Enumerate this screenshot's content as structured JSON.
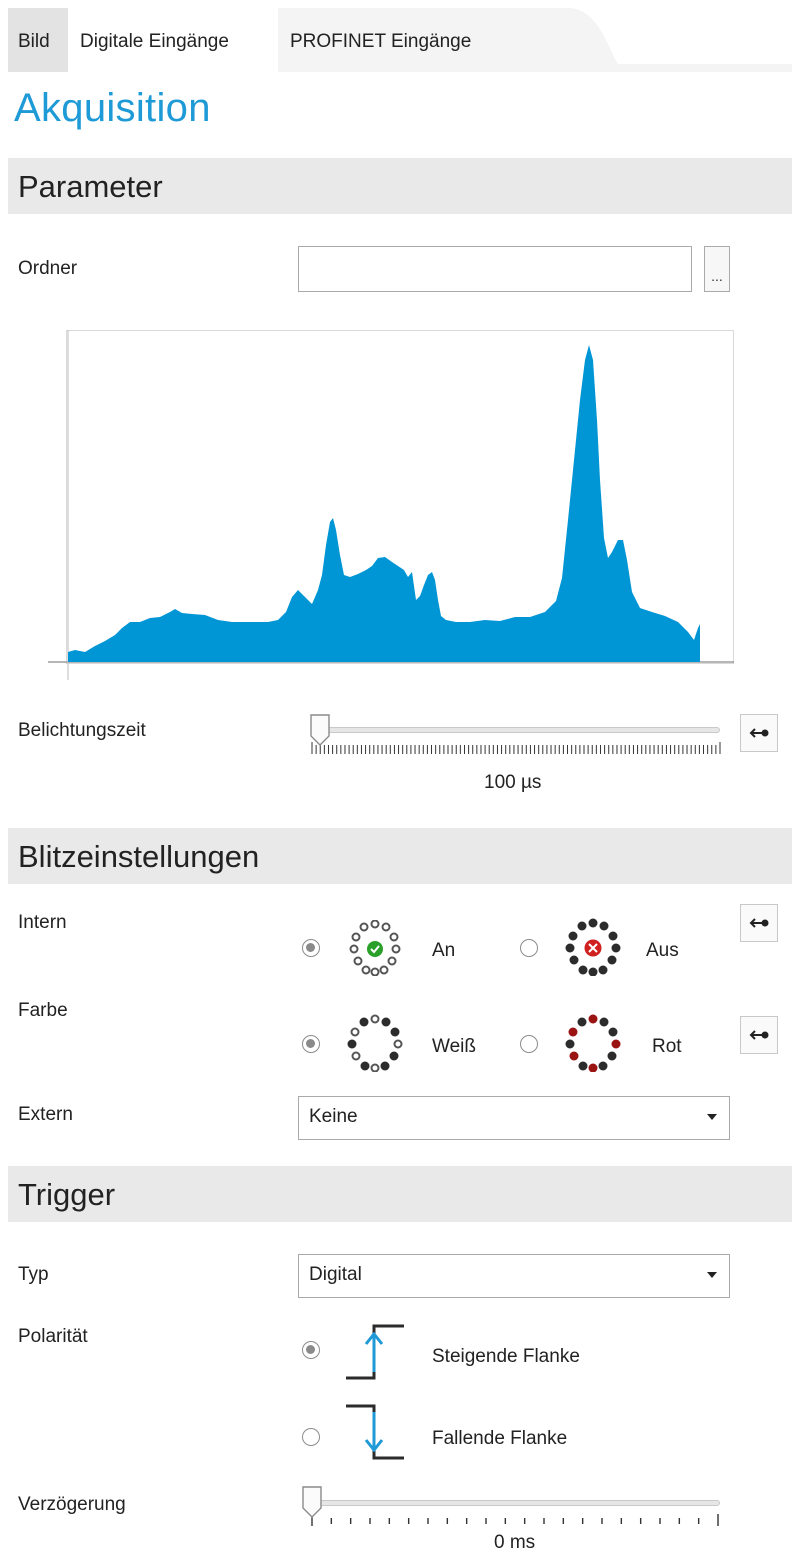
{
  "tabs": [
    {
      "label": "Bild"
    },
    {
      "label": "Digitale Eingänge"
    },
    {
      "label": "PROFINET Eingänge"
    }
  ],
  "page_title": "Akquisition",
  "sections": {
    "parameter": "Parameter",
    "blitz": "Blitzeinstellungen",
    "trigger": "Trigger"
  },
  "parameter": {
    "ordner_label": "Ordner",
    "ordner_value": "",
    "browse_button": "...",
    "belichtung_label": "Belichtungszeit",
    "belichtung_value": "100 µs",
    "belichtung_level": 0.02
  },
  "histogram_color": "#0096d6",
  "blitz": {
    "intern_label": "Intern",
    "intern_on": "An",
    "intern_off": "Aus",
    "intern_selected": "An",
    "farbe_label": "Farbe",
    "farbe_white": "Weiß",
    "farbe_red": "Rot",
    "farbe_selected": "Weiß",
    "extern_label": "Extern",
    "extern_value": "Keine"
  },
  "trigger": {
    "typ_label": "Typ",
    "typ_value": "Digital",
    "polaritaet_label": "Polarität",
    "rising": "Steigende Flanke",
    "falling": "Fallende Flanke",
    "polarity_selected": "Steigende Flanke",
    "verzoegerung_label": "Verzögerung",
    "verzoegerung_value": "0 ms",
    "verzoegerung_level": 0.0
  },
  "icons": {
    "reset": "reset-arrow-icon",
    "led_on": "led-ring-on-icon",
    "led_off": "led-ring-off-icon",
    "led_white": "led-ring-white-icon",
    "led_red": "led-ring-red-icon",
    "rising_edge": "rising-edge-icon",
    "falling_edge": "falling-edge-icon"
  },
  "colors": {
    "accent": "#1e9ad6",
    "led_on_green": "#2aa02a",
    "led_off_red": "#d02020",
    "led_red_dot": "#9b1414"
  }
}
